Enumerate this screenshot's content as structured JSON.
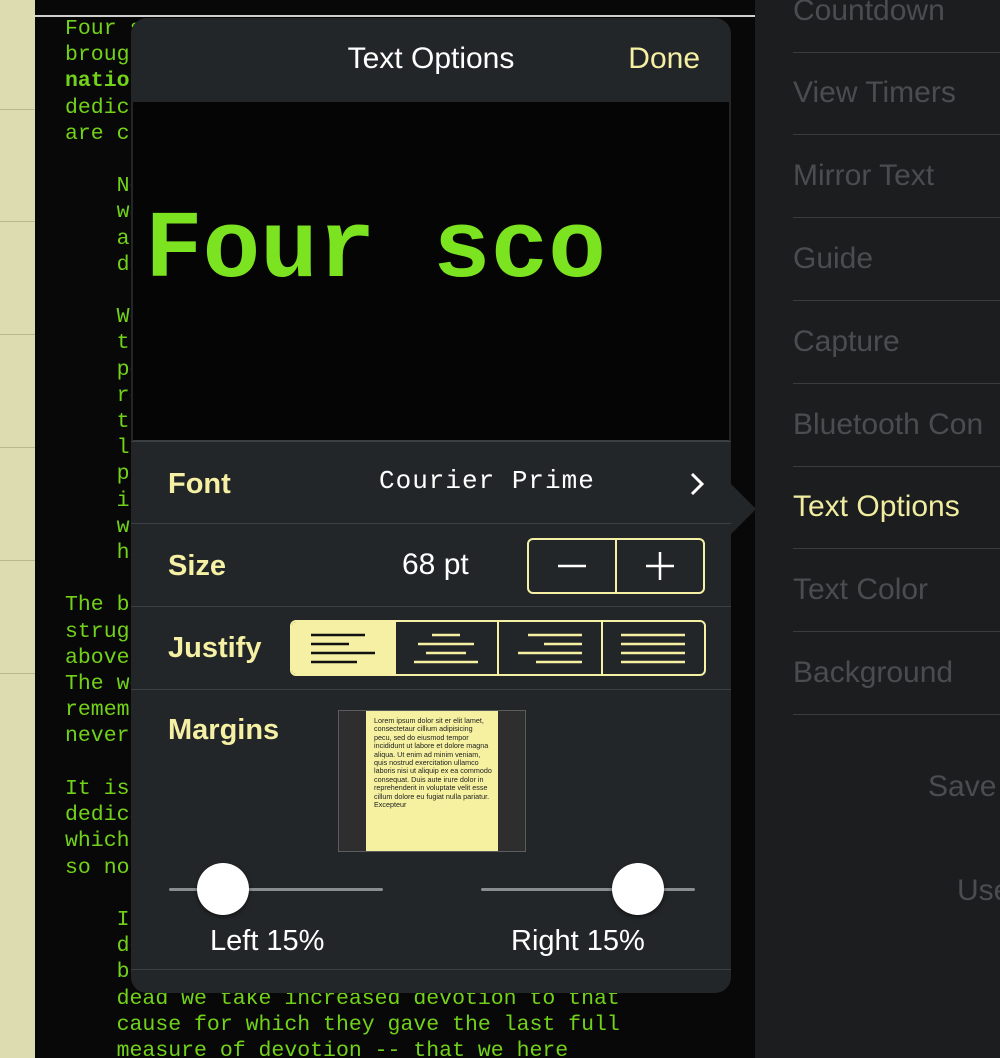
{
  "document": {
    "lines": [
      "Four score and seven years ago our fathers",
      "brought forth on this continent a new",
      "nation, conceived in liberty, and",
      "dedicated to the proposition that all men",
      "are created equal.",
      "",
      "    Now we are engaged in a great civil",
      "    war, testing whether that nation, or",
      "    any nation so conceived and so",
      "    dedicated, can long endure.",
      "",
      "    We are met on a great battle-field of",
      "    that war. We have come to dedicate a",
      "    portion of that field, as a final",
      "    resting place for those who here gave",
      "    their lives that that nation might",
      "    live. It is altogether fitting and",
      "    proper that we should do this. But,",
      "    in a larger sense, we can not dedicate",
      "    we can not consecrate, we can not",
      "    hallow this ground.",
      "",
      "The brave men, living and dead, who",
      "struggled here, have consecrated it, far",
      "above our poor power to add or detract.",
      "The world will little note, nor long",
      "remember what we say here, but it can",
      "never forget what they did here.",
      "",
      "It is for us the living, rather, to be",
      "dedicated here to the unfinished work",
      "which they who fought here have thus far",
      "so nobly advanced.",
      "",
      "    It is rather for us to be here",
      "    dedicated to the great task remaining",
      "    before us -- that from these honored",
      "    dead we take increased devotion to that",
      "    cause for which they gave the last full",
      "    measure of devotion -- that we here"
    ]
  },
  "popover": {
    "title": "Text Options",
    "done_label": "Done",
    "preview_text": "Four sco",
    "font": {
      "label": "Font",
      "value": "Courier Prime"
    },
    "size": {
      "label": "Size",
      "value": "68 pt",
      "decrement": "−",
      "increment": "+"
    },
    "justify": {
      "label": "Justify",
      "options": [
        "left",
        "center",
        "right",
        "full"
      ],
      "selected": "left"
    },
    "margins": {
      "label": "Margins",
      "sample_text": "Lorem ipsum dolor sit er elit lamet, consectetaur cillium adipisicing pecu, sed do eiusmod tempor incididunt ut labore et dolore magna aliqua. Ut enim ad minim veniam, quis nostrud exercitation ullamco laboris nisi ut aliquip ex ea commodo consequat. Duis aute irure dolor in reprehenderit in voluptate velit esse cillum dolore eu fugiat nulla pariatur. Excepteur",
      "left_label": "Left 15%",
      "right_label": "Right 15%",
      "left_percent": 15,
      "right_percent": 15
    }
  },
  "menu": {
    "items": [
      "Countdown",
      "View Timers",
      "Mirror Text",
      "Guide",
      "Capture",
      "Bluetooth Con",
      "Text Options",
      "Text Color",
      "Background"
    ],
    "active": "Text Options",
    "extra": [
      "Save",
      "Use"
    ]
  },
  "colors": {
    "accent": "#f5f0a3",
    "script_text": "#72d21a",
    "preview_text": "#7be31f"
  }
}
